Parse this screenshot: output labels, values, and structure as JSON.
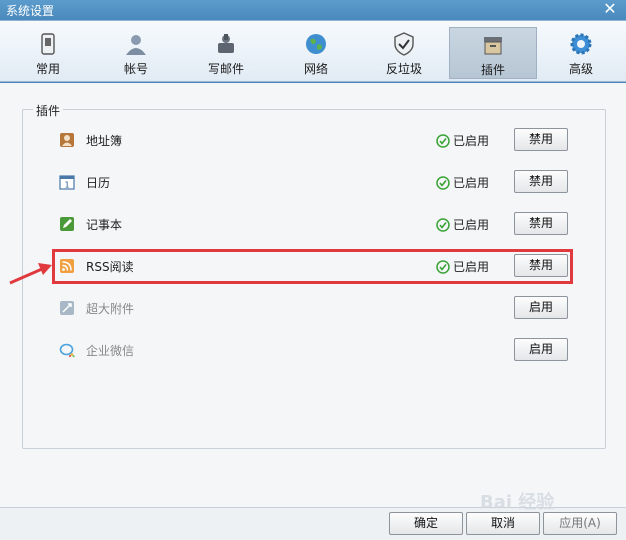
{
  "window": {
    "title": "系统设置",
    "close": "✕"
  },
  "tabs": [
    {
      "label": "常用",
      "icon": "phone-icon"
    },
    {
      "label": "帐号",
      "icon": "user-icon"
    },
    {
      "label": "写邮件",
      "icon": "compose-mail-icon"
    },
    {
      "label": "网络",
      "icon": "globe-icon"
    },
    {
      "label": "反垃圾",
      "icon": "shield-icon"
    },
    {
      "label": "插件",
      "icon": "plugin-box-icon",
      "active": true
    },
    {
      "label": "高级",
      "icon": "gear-icon"
    }
  ],
  "group": {
    "title": "插件"
  },
  "plugins": [
    {
      "name": "地址簿",
      "icon": "address-book-icon",
      "status": "已启用",
      "button": "禁用",
      "enabled": true
    },
    {
      "name": "日历",
      "icon": "calendar-icon",
      "status": "已启用",
      "button": "禁用",
      "enabled": true
    },
    {
      "name": "记事本",
      "icon": "notepad-icon",
      "status": "已启用",
      "button": "禁用",
      "enabled": true
    },
    {
      "name": "RSS阅读",
      "icon": "rss-icon",
      "status": "已启用",
      "button": "禁用",
      "enabled": true
    },
    {
      "name": "超大附件",
      "icon": "large-attachment-icon",
      "status": "",
      "button": "启用",
      "enabled": false
    },
    {
      "name": "企业微信",
      "icon": "wecom-icon",
      "status": "",
      "button": "启用",
      "enabled": false
    }
  ],
  "footer": {
    "ok": "确定",
    "cancel": "取消",
    "apply": "应用(A)"
  },
  "watermark": "Bai 经验",
  "colors": {
    "accent": "#4a89bb",
    "highlight": "#e0393e",
    "check": "#3aa335"
  }
}
